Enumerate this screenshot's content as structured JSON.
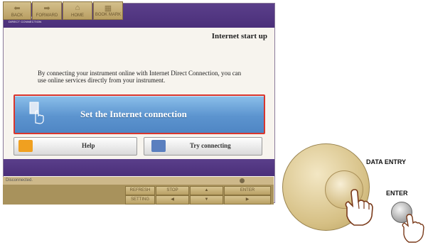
{
  "screen": {
    "logo": {
      "line1": "INTERNET",
      "line2": "DIRECT CONNECTION"
    },
    "title": "Internet start up",
    "description": "By connecting your instrument online with Internet Direct Connection, you can use online services directly from your instrument.",
    "primary_button": "Set the Internet connection",
    "help_button": "Help",
    "try_button": "Try connecting"
  },
  "status": {
    "text": "Disconnected."
  },
  "panel_buttons": {
    "back": "BACK",
    "forward": "FORWARD",
    "home": "HOME",
    "bookmark": "BOOK MARK",
    "refresh": "REFRESH",
    "setting": "SETTING",
    "stop": "STOP",
    "enter": "ENTER",
    "up": "▲",
    "down": "▼",
    "left": "◀",
    "right": "▶"
  },
  "hardware": {
    "data_entry_label": "DATA ENTRY",
    "enter_label": "ENTER"
  },
  "colors": {
    "header_purple": "#4b2f7a",
    "primary_blue": "#5c94cf",
    "highlight_red": "#d9362e",
    "panel_tan": "#a8925c"
  }
}
